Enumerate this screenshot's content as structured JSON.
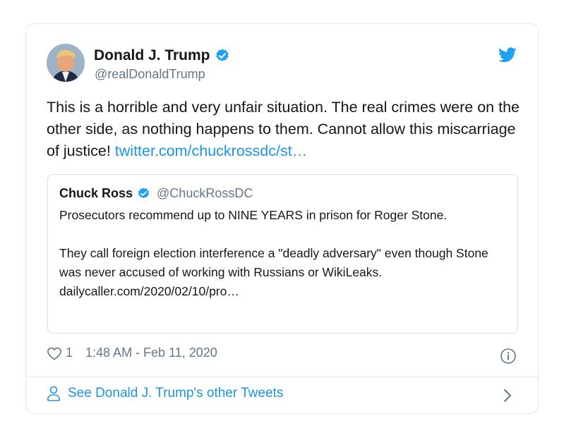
{
  "tweet": {
    "display_name": "Donald J. Trump",
    "handle": "@realDonaldTrump",
    "text": "This is a horrible and very unfair situation. The real crimes were on the other side, as nothing happens to them. Cannot allow this miscarriage of justice! ",
    "link_text": "twitter.com/chuckrossdc/st…",
    "likes": "1",
    "timestamp": "1:48 AM - Feb 11, 2020"
  },
  "quoted_tweet": {
    "display_name": "Chuck Ross",
    "handle": "@ChuckRossDC",
    "text": "Prosecutors recommend up to NINE YEARS in prison for Roger Stone.\n\nThey call foreign election interference a \"deadly adversary\" even though Stone was never accused of working with Russians or WikiLeaks.  dailycaller.com/2020/02/10/pro…"
  },
  "footer": {
    "label": "See Donald J. Trump's other Tweets"
  },
  "colors": {
    "link": "#1b95e0",
    "verified": "#1da1f2",
    "secondary_text": "#657786",
    "border": "#e1e8ed"
  },
  "icons": [
    "verified-icon",
    "twitter-bird-icon",
    "heart-icon",
    "info-icon",
    "person-icon",
    "chevron-right-icon"
  ]
}
